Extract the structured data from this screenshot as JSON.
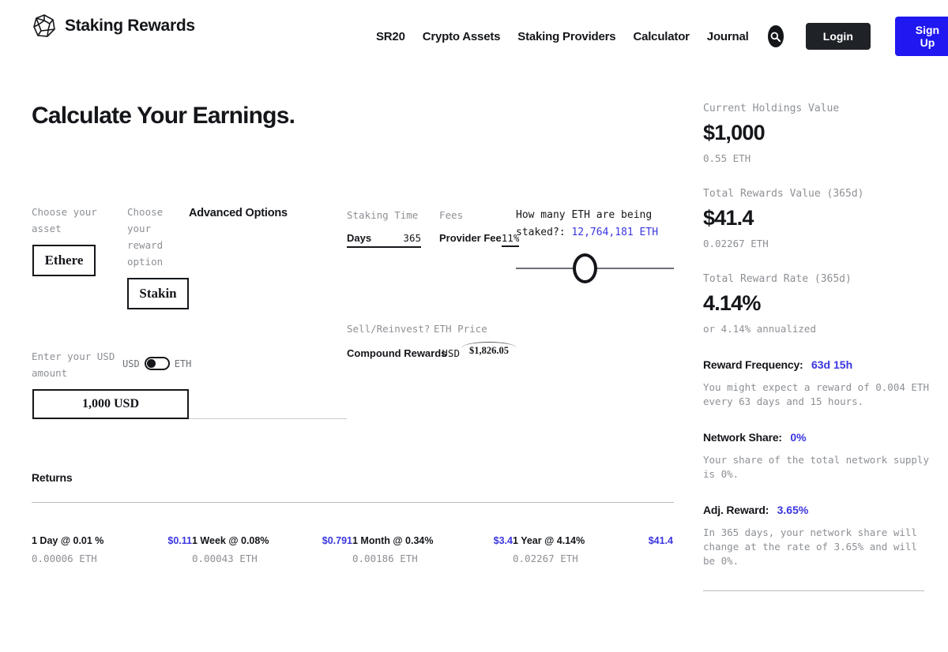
{
  "brand": {
    "name": "Staking Rewards",
    "logo_icon": "polyhedron-logo-icon"
  },
  "nav": {
    "items": [
      {
        "label": "SR20"
      },
      {
        "label": "Crypto Assets"
      },
      {
        "label": "Staking Providers"
      },
      {
        "label": "Calculator"
      },
      {
        "label": "Journal"
      }
    ],
    "search_icon": "search-icon",
    "login_label": "Login",
    "signup_label": "Sign Up"
  },
  "page": {
    "title": "Calculate Your Earnings."
  },
  "form": {
    "asset_label": "Choose your asset",
    "asset_value": "Ethere",
    "reward_label": "Choose your reward option",
    "reward_value": "Stakin",
    "advanced_options_label": "Advanced Options",
    "staking_time_label": "Staking Time",
    "fees_label": "Fees",
    "days_label": "Days",
    "days_value": "365",
    "provider_fee_label": "Provider Fee",
    "provider_fee_value": "11%",
    "staked_question": "How many ETH are being staked?:",
    "staked_amount": "12,764,181 ETH",
    "sell_reinvest_label": "Sell/Reinvest?",
    "eth_price_label": "ETH Price",
    "compound_rewards_label": "Compound Rewards",
    "compound_toggle_value": "USD",
    "eth_price_value": "$1,826.05",
    "amount_label": "Enter your USD amount",
    "unit_left": "USD",
    "unit_right": "ETH",
    "amount_value": "1,000 USD"
  },
  "returns": {
    "title": "Returns",
    "rows": [
      {
        "period": "1 Day @ 0.01 %",
        "value": "$0.11",
        "eth": "0.00006 ETH"
      },
      {
        "period": "1 Week @ 0.08%",
        "value": "$0.791",
        "eth": "0.00043 ETH"
      },
      {
        "period": "1 Month @ 0.34%",
        "value": "$3.4",
        "eth": "0.00186 ETH"
      },
      {
        "period": "1 Year @ 4.14%",
        "value": "$41.4",
        "eth": "0.02267 ETH"
      }
    ]
  },
  "sidebar": {
    "holdings_label": "Current Holdings Value",
    "holdings_value": "$1,000",
    "holdings_sub": "0.55 ETH",
    "rewards_label": "Total Rewards Value (365d)",
    "rewards_value": "$41.4",
    "rewards_sub": "0.02267 ETH",
    "rate_label": "Total Reward Rate (365d)",
    "rate_value": "4.14%",
    "rate_sub": "or 4.14% annualized",
    "frequency_key": "Reward Frequency:",
    "frequency_value": "63d 15h",
    "frequency_desc": "You might expect a reward of 0.004 ETH every 63 days and 15 hours.",
    "network_key": "Network Share:",
    "network_value": "0%",
    "network_desc": "Your share of the total network supply is 0%.",
    "adj_key": "Adj. Reward:",
    "adj_value": "3.65%",
    "adj_desc": "In 365 days, your network share will change at the rate of 3.65% and will be 0%."
  },
  "colors": {
    "accent_blue": "#2018f0",
    "link_blue": "#3a36e0",
    "dark": "#14161a",
    "muted": "#8d9095"
  }
}
